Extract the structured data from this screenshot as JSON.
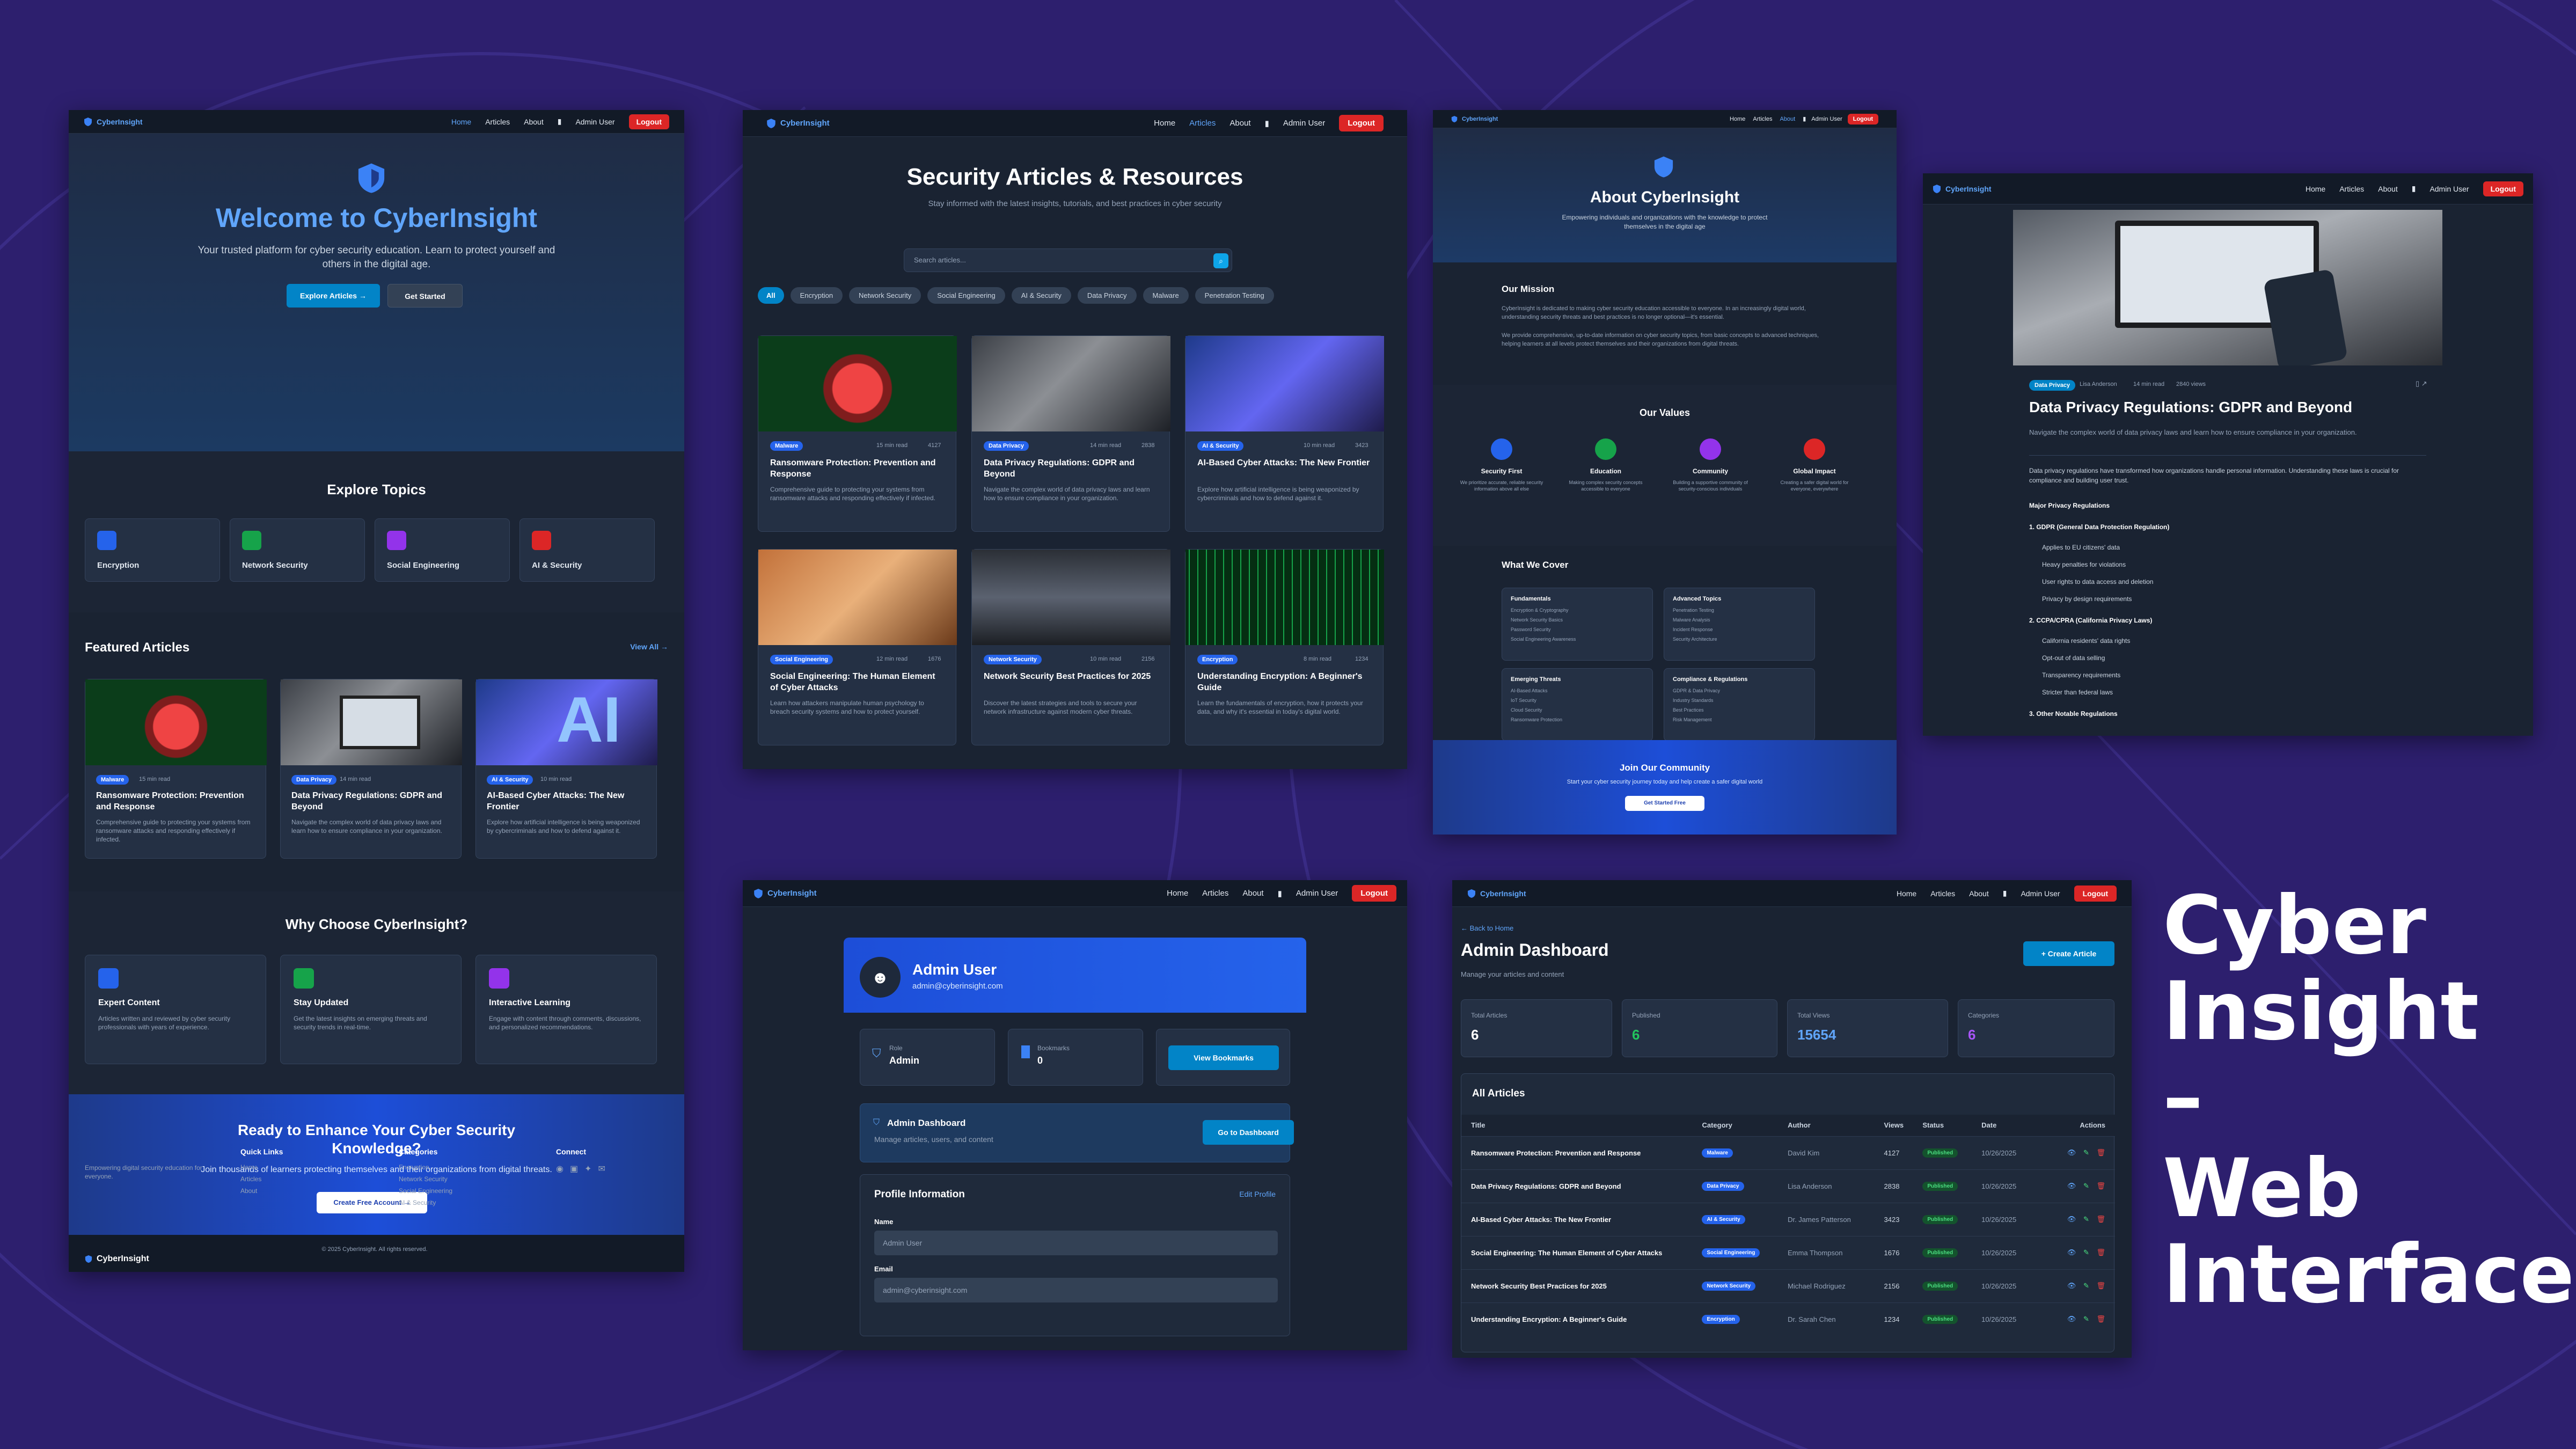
{
  "brand": "CyberInsight",
  "nav": {
    "home": "Home",
    "articles": "Articles",
    "about": "About",
    "user": "Admin User",
    "logout": "Logout"
  },
  "title_overlay": {
    "line1": "Cyber",
    "line2": "Insight",
    "line3": "–",
    "line4": "Web",
    "line5": "Interface"
  },
  "home": {
    "hero_title": "Welcome to CyberInsight",
    "hero_sub": "Your trusted platform for cyber security education. Learn to protect yourself and others in the digital age.",
    "btn_explore": "Explore Articles →",
    "btn_start": "Get Started",
    "topics_title": "Explore Topics",
    "topics": [
      "Encryption",
      "Network Security",
      "Social Engineering",
      "AI & Security"
    ],
    "featured_title": "Featured Articles",
    "view_all": "View All →",
    "featured": [
      {
        "tag": "Malware",
        "read": "15 min read",
        "title": "Ransomware Protection: Prevention and Response",
        "desc": "Comprehensive guide to protecting your systems from ransomware attacks and responding effectively if infected."
      },
      {
        "tag": "Data Privacy",
        "read": "14 min read",
        "title": "Data Privacy Regulations: GDPR and Beyond",
        "desc": "Navigate the complex world of data privacy laws and learn how to ensure compliance in your organization."
      },
      {
        "tag": "AI & Security",
        "read": "10 min read",
        "title": "AI-Based Cyber Attacks: The New Frontier",
        "desc": "Explore how artificial intelligence is being weaponized by cybercriminals and how to defend against it."
      }
    ],
    "why_title": "Why Choose CyberInsight?",
    "why": [
      {
        "title": "Expert Content",
        "desc": "Articles written and reviewed by cyber security professionals with years of experience."
      },
      {
        "title": "Stay Updated",
        "desc": "Get the latest insights on emerging threats and security trends in real-time."
      },
      {
        "title": "Interactive Learning",
        "desc": "Engage with content through comments, discussions, and personalized recommendations."
      }
    ],
    "cta_title": "Ready to Enhance Your Cyber Security Knowledge?",
    "cta_sub": "Join thousands of learners protecting themselves and their organizations from digital threats.",
    "cta_btn": "Create Free Account →",
    "footer_desc": "Empowering digital security education for everyone.",
    "quick_links": "Quick Links",
    "quick": [
      "Home",
      "Articles",
      "About"
    ],
    "categories": "Categories",
    "cats": [
      "Encryption",
      "Network Security",
      "Social Engineering",
      "AI & Security"
    ],
    "connect": "Connect",
    "copyright": "© 2025 CyberInsight. All rights reserved."
  },
  "articles": {
    "title": "Security Articles & Resources",
    "sub": "Stay informed with the latest insights, tutorials, and best practices in cyber security",
    "search_placeholder": "Search articles...",
    "filters": [
      "All",
      "Encryption",
      "Network Security",
      "Social Engineering",
      "AI & Security",
      "Data Privacy",
      "Malware",
      "Penetration Testing"
    ],
    "items": [
      {
        "tag": "Malware",
        "read": "15 min read",
        "views": "4127",
        "title": "Ransomware Protection: Prevention and Response",
        "desc": "Comprehensive guide to protecting your systems from ransomware attacks and responding effectively if infected."
      },
      {
        "tag": "Data Privacy",
        "read": "14 min read",
        "views": "2838",
        "title": "Data Privacy Regulations: GDPR and Beyond",
        "desc": "Navigate the complex world of data privacy laws and learn how to ensure compliance in your organization."
      },
      {
        "tag": "AI & Security",
        "read": "10 min read",
        "views": "3423",
        "title": "AI-Based Cyber Attacks: The New Frontier",
        "desc": "Explore how artificial intelligence is being weaponized by cybercriminals and how to defend against it."
      },
      {
        "tag": "Social Engineering",
        "read": "12 min read",
        "views": "1676",
        "title": "Social Engineering: The Human Element of Cyber Attacks",
        "desc": "Learn how attackers manipulate human psychology to breach security systems and how to protect yourself."
      },
      {
        "tag": "Network Security",
        "read": "10 min read",
        "views": "2156",
        "title": "Network Security Best Practices for 2025",
        "desc": "Discover the latest strategies and tools to secure your network infrastructure against modern cyber threats."
      },
      {
        "tag": "Encryption",
        "read": "8 min read",
        "views": "1234",
        "title": "Understanding Encryption: A Beginner's Guide",
        "desc": "Learn the fundamentals of encryption, how it protects your data, and why it's essential in today's digital world."
      }
    ]
  },
  "about": {
    "title": "About CyberInsight",
    "sub": "Empowering individuals and organizations with the knowledge to protect themselves in the digital age",
    "mission_title": "Our Mission",
    "mission_p1": "CyberInsight is dedicated to making cyber security education accessible to everyone. In an increasingly digital world, understanding security threats and best practices is no longer optional—it's essential.",
    "mission_p2": "We provide comprehensive, up-to-date information on cyber security topics, from basic concepts to advanced techniques, helping learners at all levels protect themselves and their organizations from digital threats.",
    "values_title": "Our Values",
    "values": [
      {
        "title": "Security First",
        "desc": "We prioritize accurate, reliable security information above all else"
      },
      {
        "title": "Education",
        "desc": "Making complex security concepts accessible to everyone"
      },
      {
        "title": "Community",
        "desc": "Building a supportive community of security-conscious individuals"
      },
      {
        "title": "Global Impact",
        "desc": "Creating a safer digital world for everyone, everywhere"
      }
    ],
    "cover_title": "What We Cover",
    "cover": [
      {
        "title": "Fundamentals",
        "items": [
          "Encryption & Cryptography",
          "Network Security Basics",
          "Password Security",
          "Social Engineering Awareness"
        ]
      },
      {
        "title": "Advanced Topics",
        "items": [
          "Penetration Testing",
          "Malware Analysis",
          "Incident Response",
          "Security Architecture"
        ]
      },
      {
        "title": "Emerging Threats",
        "items": [
          "AI-Based Attacks",
          "IoT Security",
          "Cloud Security",
          "Ransomware Protection"
        ]
      },
      {
        "title": "Compliance & Regulations",
        "items": [
          "GDPR & Data Privacy",
          "Industry Standards",
          "Best Practices",
          "Risk Management"
        ]
      }
    ],
    "join_title": "Join Our Community",
    "join_sub": "Start your cyber security journey today and help create a safer digital world",
    "join_btn": "Get Started Free"
  },
  "detail": {
    "tag": "Data Privacy",
    "author": "Lisa Anderson",
    "read": "14 min read",
    "views": "2840 views",
    "title": "Data Privacy Regulations: GDPR and Beyond",
    "lead": "Navigate the complex world of data privacy laws and learn how to ensure compliance in your organization.",
    "p1": "Data privacy regulations have transformed how organizations handle personal information. Understanding these laws is crucial for compliance and building user trust.",
    "h_major": "Major Privacy Regulations",
    "h_gdpr": "1. GDPR (General Data Protection Regulation)",
    "gdpr": [
      "Applies to EU citizens' data",
      "Heavy penalties for violations",
      "User rights to data access and deletion",
      "Privacy by design requirements"
    ],
    "h_ccpa": "2. CCPA/CPRA (California Privacy Laws)",
    "ccpa": [
      "California residents' data rights",
      "Opt-out of data selling",
      "Transparency requirements",
      "Stricter than federal laws"
    ],
    "h_other": "3. Other Notable Regulations"
  },
  "profile": {
    "name": "Admin User",
    "email": "admin@cyberinsight.com",
    "role_label": "Role",
    "role": "Admin",
    "bookmarks_label": "Bookmarks",
    "bookmarks": "0",
    "view_bookmarks": "View Bookmarks",
    "dash_title": "Admin Dashboard",
    "dash_sub": "Manage articles, users, and content",
    "dash_btn": "Go to Dashboard",
    "info_title": "Profile Information",
    "edit": "Edit Profile",
    "name_label": "Name",
    "name_value": "Admin User",
    "email_label": "Email",
    "email_value": "admin@cyberinsight.com"
  },
  "dashboard": {
    "back": "← Back to Home",
    "title": "Admin Dashboard",
    "sub": "Manage your articles and content",
    "create": "+ Create Article",
    "stats": [
      {
        "label": "Total Articles",
        "value": "6"
      },
      {
        "label": "Published",
        "value": "6"
      },
      {
        "label": "Total Views",
        "value": "15654"
      },
      {
        "label": "Categories",
        "value": "6"
      }
    ],
    "all_title": "All Articles",
    "columns": [
      "Title",
      "Category",
      "Author",
      "Views",
      "Status",
      "Date",
      "Actions"
    ],
    "rows": [
      {
        "title": "Ransomware Protection: Prevention and Response",
        "cat": "Malware",
        "author": "David Kim",
        "views": "4127",
        "status": "Published",
        "date": "10/26/2025"
      },
      {
        "title": "Data Privacy Regulations: GDPR and Beyond",
        "cat": "Data Privacy",
        "author": "Lisa Anderson",
        "views": "2838",
        "status": "Published",
        "date": "10/26/2025"
      },
      {
        "title": "AI-Based Cyber Attacks: The New Frontier",
        "cat": "AI & Security",
        "author": "Dr. James Patterson",
        "views": "3423",
        "status": "Published",
        "date": "10/26/2025"
      },
      {
        "title": "Social Engineering: The Human Element of Cyber Attacks",
        "cat": "Social Engineering",
        "author": "Emma Thompson",
        "views": "1676",
        "status": "Published",
        "date": "10/26/2025"
      },
      {
        "title": "Network Security Best Practices for 2025",
        "cat": "Network Security",
        "author": "Michael Rodriguez",
        "views": "2156",
        "status": "Published",
        "date": "10/26/2025"
      },
      {
        "title": "Understanding Encryption: A Beginner's Guide",
        "cat": "Encryption",
        "author": "Dr. Sarah Chen",
        "views": "1234",
        "status": "Published",
        "date": "10/26/2025"
      }
    ]
  }
}
